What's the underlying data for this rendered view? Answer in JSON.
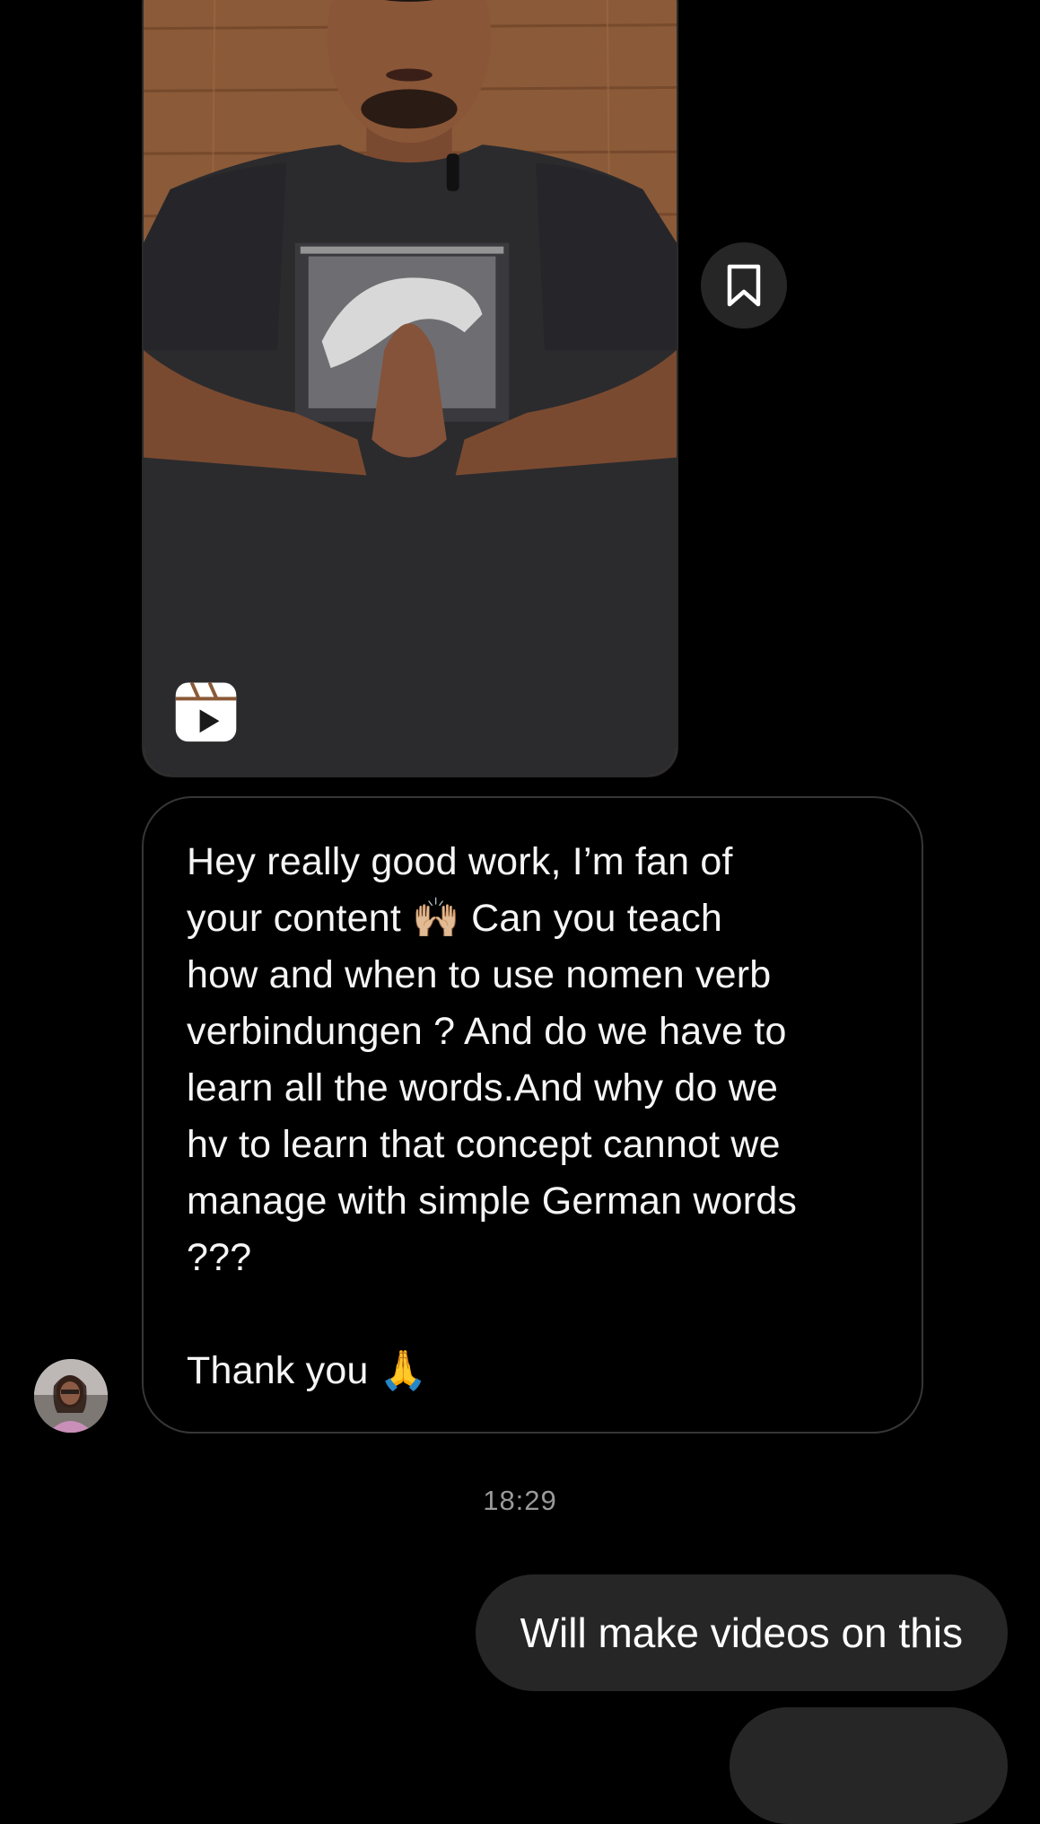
{
  "shared_reel": {
    "thumbnail_icon": "reel-play-icon",
    "save_icon": "bookmark-icon"
  },
  "incoming_message": {
    "text": "Hey really good work, I’m fan of\nyour content 🙌🏼 Can you teach\nhow and when to use nomen verb\nverbindungen ? And do we have to\nlearn all the words.And why do we\nhv to learn that concept cannot we\nmanage with simple German words\n???\n\nThank you 🙏",
    "avatar_icon": "user-avatar"
  },
  "timestamp": "18:29",
  "outgoing_message": {
    "text": "Will make videos on this"
  },
  "colors": {
    "background": "#000000",
    "bubble_dark": "#262626",
    "bubble_border": "#363636",
    "timestamp_gray": "#9a9a9a"
  }
}
